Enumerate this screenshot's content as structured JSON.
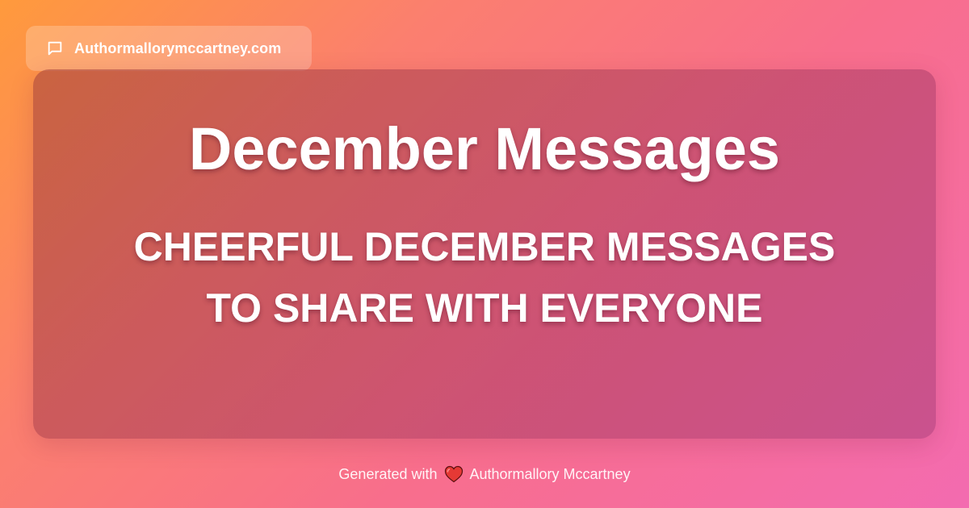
{
  "site": {
    "icon": "chat-bubble-icon",
    "domain": "Authormallorymccartney.com"
  },
  "card": {
    "title": "December Messages",
    "subtitle": "CHEERFUL DECEMBER MESSAGES TO SHARE WITH EVERYONE"
  },
  "footer": {
    "prefix": "Generated with",
    "icon": "heart-icon",
    "author": "Authormallory Mccartney"
  },
  "colors": {
    "gradient_start": "#ff9a3c",
    "gradient_end": "#f36bb0",
    "heart": "#e53935",
    "text": "#ffffff"
  }
}
